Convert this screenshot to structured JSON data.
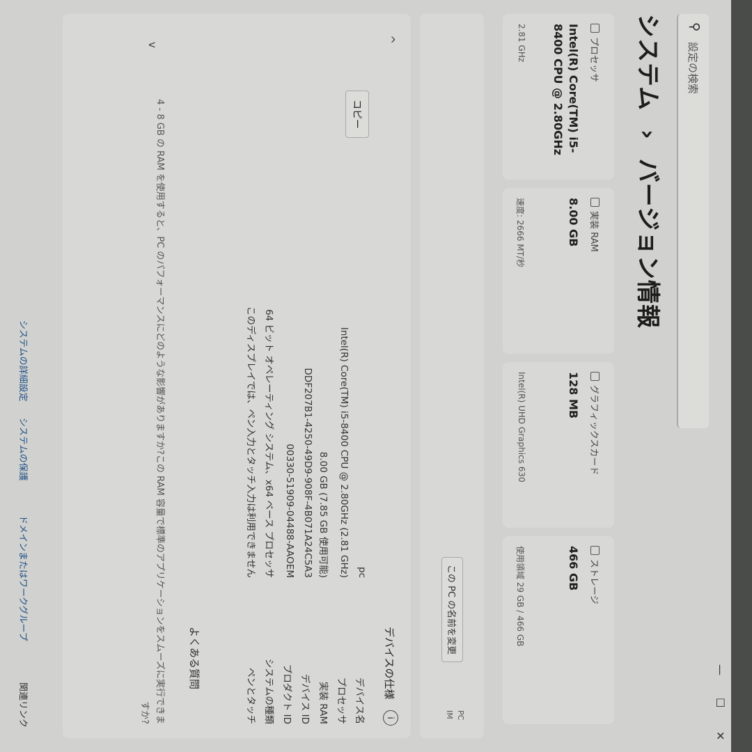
{
  "window": {
    "controls": {
      "minimize": "—",
      "maximize": "☐",
      "close": "✕"
    }
  },
  "search": {
    "placeholder": "設定の検索"
  },
  "header": {
    "section": "システム",
    "separator": "›",
    "page": "バージョン情報"
  },
  "cards": [
    {
      "label": "プロセッサ",
      "value": "Intel(R) Core(TM) i5-8400 CPU @ 2.80GHz",
      "sub": "2.81 GHz"
    },
    {
      "label": "実装 RAM",
      "value": "8.00 GB",
      "sub": "速度: 2666 MT/秒"
    },
    {
      "label": "グラフィックスカード",
      "value": "128 MB",
      "sub": "Intel(R) UHD Graphics 630"
    },
    {
      "label": "ストレージ",
      "value": "466 GB",
      "sub": "使用領域 29 GB / 466 GB"
    }
  ],
  "rename": {
    "pc_line1": "PC",
    "pc_line2": "IM",
    "button": "この PC の名前を変更"
  },
  "specs": {
    "title": "デバイスの仕様",
    "copy": "コピー",
    "rows": [
      {
        "key": "デバイス名",
        "value": "pc"
      },
      {
        "key": "プロセッサ",
        "value": "Intel(R) Core(TM) i5-8400 CPU @ 2.80GHz (2.81 GHz)"
      },
      {
        "key": "実装 RAM",
        "value": "8.00 GB (7.85 GB 使用可能)"
      },
      {
        "key": "デバイス ID",
        "value": "DDF207B1-4250-49D9-908F-4B071A24C5A3"
      },
      {
        "key": "プロダクト ID",
        "value": "00330-51909-04488-AAOEM"
      },
      {
        "key": "システムの種類",
        "value": "64 ビット オペレーティング システム、x64 ベース プロセッサ"
      },
      {
        "key": "ペンとタッチ",
        "value": "このディスプレイでは、ペン入力とタッチ入力は利用できません"
      }
    ],
    "faq_title": "よくある質問",
    "faq_question": "4 - 8 GB の RAM を使用すると、PC のパフォーマンスにどのような影響がありますか?この RAM 容量で標準のアプリケーションをスムーズに実行できますか?"
  },
  "related_links": {
    "label": "関連リンク",
    "items": [
      "ドメインまたはワークグループ",
      "システムの保護",
      "システムの詳細設定"
    ]
  },
  "colors": {
    "link": "#1f4f86",
    "background": "#d1d2cf",
    "card": "#d8d9d6"
  }
}
